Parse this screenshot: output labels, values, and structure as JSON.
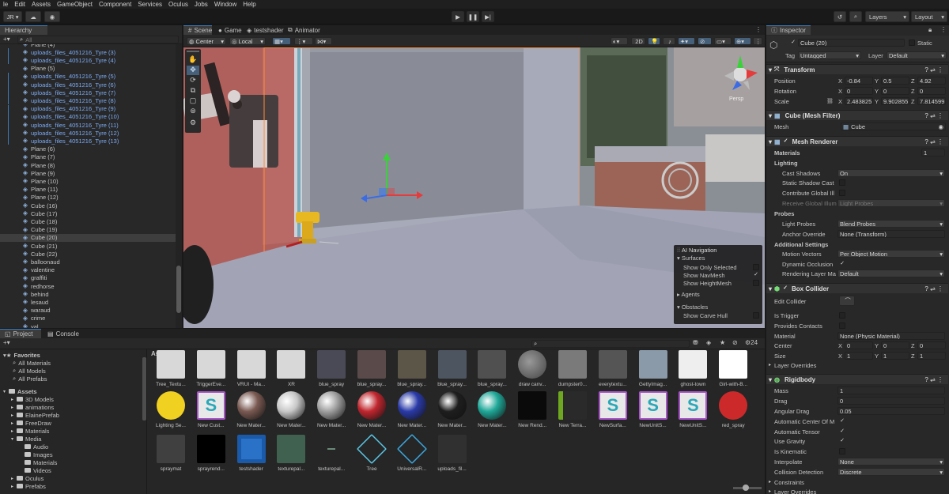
{
  "menu": [
    "le",
    "Edit",
    "Assets",
    "GameObject",
    "Component",
    "Services",
    "Oculus",
    "Jobs",
    "Window",
    "Help"
  ],
  "toolbar": {
    "account": "JR ▾",
    "layers": "Layers",
    "layout": "Layout"
  },
  "hierarchy": {
    "tab": "Hierarchy",
    "search_placeholder": "All",
    "items": [
      {
        "label": "Plane (4)",
        "blue": false
      },
      {
        "label": "uploads_files_4051216_Tyre (3)",
        "blue": true
      },
      {
        "label": "uploads_files_4051216_Tyre (4)",
        "blue": true
      },
      {
        "label": "Plane (5)",
        "blue": false
      },
      {
        "label": "uploads_files_4051216_Tyre (5)",
        "blue": true
      },
      {
        "label": "uploads_files_4051216_Tyre (6)",
        "blue": true
      },
      {
        "label": "uploads_files_4051216_Tyre (7)",
        "blue": true
      },
      {
        "label": "uploads_files_4051216_Tyre (8)",
        "blue": true
      },
      {
        "label": "uploads_files_4051216_Tyre (9)",
        "blue": true
      },
      {
        "label": "uploads_files_4051216_Tyre (10)",
        "blue": true
      },
      {
        "label": "uploads_files_4051216_Tyre (11)",
        "blue": true
      },
      {
        "label": "uploads_files_4051216_Tyre (12)",
        "blue": true
      },
      {
        "label": "uploads_files_4051216_Tyre (13)",
        "blue": true
      },
      {
        "label": "Plane (6)",
        "blue": false
      },
      {
        "label": "Plane (7)",
        "blue": false
      },
      {
        "label": "Plane (8)",
        "blue": false
      },
      {
        "label": "Plane (9)",
        "blue": false
      },
      {
        "label": "Plane (10)",
        "blue": false
      },
      {
        "label": "Plane (11)",
        "blue": false
      },
      {
        "label": "Plane (12)",
        "blue": false
      },
      {
        "label": "Cube (16)",
        "blue": false
      },
      {
        "label": "Cube (17)",
        "blue": false
      },
      {
        "label": "Cube (18)",
        "blue": false
      },
      {
        "label": "Cube (19)",
        "blue": false
      },
      {
        "label": "Cube (20)",
        "blue": false,
        "selected": true
      },
      {
        "label": "Cube (21)",
        "blue": false
      },
      {
        "label": "Cube (22)",
        "blue": false
      },
      {
        "label": "balloonaud",
        "blue": false
      },
      {
        "label": "valentine",
        "blue": false
      },
      {
        "label": "graffiti",
        "blue": false
      },
      {
        "label": "redhorse",
        "blue": false
      },
      {
        "label": "behind",
        "blue": false
      },
      {
        "label": "lesaud",
        "blue": false
      },
      {
        "label": "waraud",
        "blue": false
      },
      {
        "label": "crime",
        "blue": false
      },
      {
        "label": "val",
        "blue": false
      }
    ]
  },
  "scene": {
    "tabs": [
      "Scene",
      "Game",
      "testshader",
      "Animator"
    ],
    "pivot": "Center",
    "space": "Local",
    "mode_2d": "2D",
    "persp": "Persp",
    "nav_overlay": {
      "title": "AI Navigation",
      "surfaces": "Surfaces",
      "show_only_selected": "Show Only Selected",
      "show_navmesh": "Show NavMesh",
      "show_heightmesh": "Show HeightMesh",
      "agents": "Agents",
      "obstacles": "Obstacles",
      "show_carve_hull": "Show Carve Hull"
    }
  },
  "bottom": {
    "tabs": [
      "Project",
      "Console"
    ],
    "assets_heading": "Assets",
    "favorites": [
      "Favorites",
      "All Materials",
      "All Models",
      "All Prefabs"
    ],
    "tree": [
      {
        "label": "Assets",
        "indent": 0,
        "bold": true
      },
      {
        "label": "3D Models",
        "indent": 1
      },
      {
        "label": "animations",
        "indent": 1
      },
      {
        "label": "ElainePrefab",
        "indent": 1
      },
      {
        "label": "FreeDraw",
        "indent": 1
      },
      {
        "label": "Materials",
        "indent": 1
      },
      {
        "label": "Media",
        "indent": 1
      },
      {
        "label": "Audio",
        "indent": 2
      },
      {
        "label": "Images",
        "indent": 2
      },
      {
        "label": "Materials",
        "indent": 2
      },
      {
        "label": "Videos",
        "indent": 2
      },
      {
        "label": "Oculus",
        "indent": 1
      },
      {
        "label": "Prefabs",
        "indent": 1
      }
    ],
    "count": "24",
    "row1": [
      "Tree_Textu...",
      "TriggerEve...",
      "VRUI - Ma...",
      "XR",
      "blue_spray",
      "blue_spray...",
      "blue_spray...",
      "blue_spray...",
      "blue_spray...",
      "draw canv...",
      "dumpster0...",
      "everytextu...",
      "GettyImag...",
      "ghost-town",
      "Girl-with-B..."
    ],
    "row2": [
      "Lighting Se...",
      "New Cust...",
      "New Mater...",
      "New Mater...",
      "New Mater...",
      "New Mater...",
      "New Mater...",
      "New Mater...",
      "New Mater...",
      "New Rend...",
      "New Terra...",
      "NewSurfa...",
      "NewUnitS...",
      "NewUnitS...",
      "red_spray"
    ],
    "row3": [
      "spraymat",
      "sprayrend...",
      "testshader",
      "texturepal...",
      "texturepal...",
      "Tree",
      "UniversalR...",
      "uploads_fil..."
    ]
  },
  "inspector": {
    "tab": "Inspector",
    "name": "Cube (20)",
    "static": "Static",
    "tag_label": "Tag",
    "tag": "Untagged",
    "layer_label": "Layer",
    "layer": "Default",
    "transform": {
      "title": "Transform",
      "position": {
        "label": "Position",
        "x": "-0.84",
        "y": "0.5",
        "z": "4.92"
      },
      "rotation": {
        "label": "Rotation",
        "x": "0",
        "y": "0",
        "z": "0"
      },
      "scale": {
        "label": "Scale",
        "x": "2.483825",
        "y": "9.902855",
        "z": "7.814599"
      }
    },
    "mesh_filter": {
      "title": "Cube (Mesh Filter)",
      "label": "Mesh",
      "value": "Cube"
    },
    "mesh_renderer": {
      "title": "Mesh Renderer",
      "materials": "Materials",
      "materials_count": "1",
      "lighting": "Lighting",
      "cast_shadows": "Cast Shadows",
      "cast_shadows_val": "On",
      "static_shadow": "Static Shadow Cast",
      "contribute_gi": "Contribute Global Ill",
      "receive_gi": "Receive Global Illum",
      "receive_gi_val": "Light Probes",
      "probes": "Probes",
      "light_probes": "Light Probes",
      "light_probes_val": "Blend Probes",
      "anchor": "Anchor Override",
      "anchor_val": "None (Transform)",
      "additional": "Additional Settings",
      "motion": "Motion Vectors",
      "motion_val": "Per Object Motion",
      "dyn_occ": "Dynamic Occlusion",
      "render_layer": "Rendering Layer Ma",
      "render_layer_val": "Default"
    },
    "box_collider": {
      "title": "Box Collider",
      "edit": "Edit Collider",
      "trigger": "Is Trigger",
      "contacts": "Provides Contacts",
      "material": "Material",
      "material_val": "None (Physic Material)",
      "center": {
        "label": "Center",
        "x": "0",
        "y": "0",
        "z": "0"
      },
      "size": {
        "label": "Size",
        "x": "1",
        "y": "1",
        "z": "1"
      },
      "overrides": "Layer Overrides"
    },
    "rigidbody": {
      "title": "Rigidbody",
      "mass": "Mass",
      "mass_val": "1",
      "drag": "Drag",
      "drag_val": "0",
      "ang_drag": "Angular Drag",
      "ang_drag_val": "0.05",
      "auto_center": "Automatic Center Of M",
      "auto_tensor": "Automatic Tensor",
      "gravity": "Use Gravity",
      "kinematic": "Is Kinematic",
      "interpolate": "Interpolate",
      "interpolate_val": "None",
      "collision": "Collision Detection",
      "collision_val": "Discrete",
      "constraints": "Constraints",
      "overrides": "Layer Overrides"
    }
  }
}
